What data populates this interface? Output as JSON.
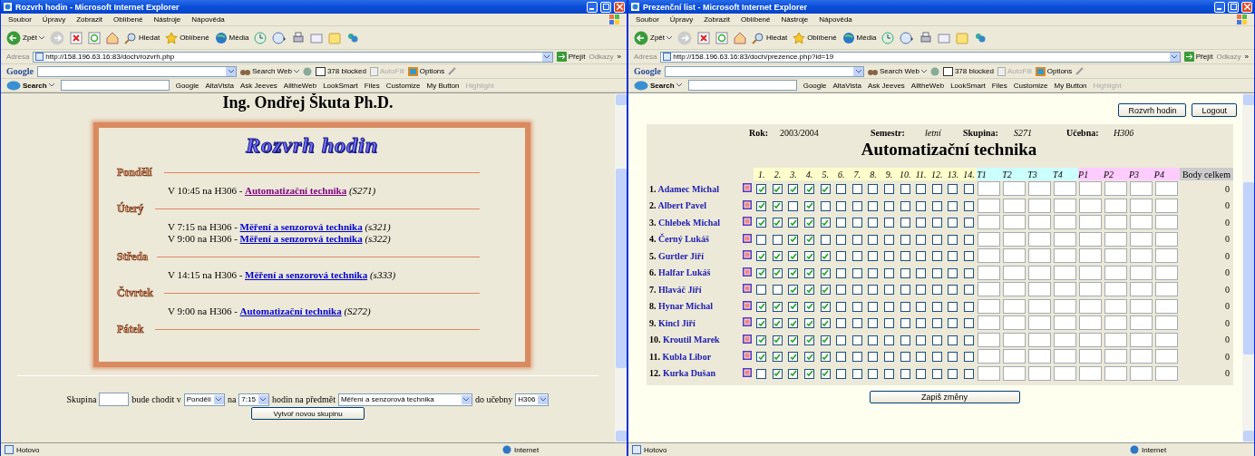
{
  "windows": [
    {
      "title": "Rozvrh hodin - Microsoft Internet Explorer",
      "menu": [
        "Soubor",
        "Úpravy",
        "Zobrazit",
        "Oblíbené",
        "Nástroje",
        "Nápověda"
      ],
      "toolbar": {
        "back": "Zpět",
        "search": "Hledat",
        "favorites": "Oblíbené",
        "media": "Média"
      },
      "address": {
        "label": "Adresa",
        "url": "http://158.196.63.16:83/doch/rozvrh.php",
        "go": "Přejít",
        "links": "Odkazy",
        "more": "»"
      },
      "google_bar": {
        "logo": "Google",
        "search_web": "Search Web",
        "blocked": "378 blocked",
        "autofill": "AutoFill",
        "options": "Options"
      },
      "search_bar": {
        "label": "Search",
        "items": [
          "Google",
          "AltaVista",
          "Ask Jeeves",
          "AlltheWeb",
          "LookSmart",
          "Files",
          "Customize",
          "My Button",
          "Highlight"
        ]
      },
      "status": {
        "text": "Hotovo",
        "zone": "Internet"
      },
      "kind": "schedule",
      "page": {
        "heading": "Ing. Ondřej Škuta Ph.D.",
        "title": "Rozvrh hodin",
        "days": [
          {
            "name": "Pondělí",
            "entries": [
              {
                "text": "V 10:45 na H306 - ",
                "link": "Automatizační technika",
                "visited": true,
                "group": "(S271)"
              }
            ]
          },
          {
            "name": "Úterý",
            "entries": [
              {
                "text": "V 7:15 na H306 - ",
                "link": "Měření a senzorová technika",
                "visited": false,
                "group": "(s321)"
              },
              {
                "text": "V 9:00 na H306 - ",
                "link": "Měření a senzorová technika",
                "visited": false,
                "group": "(s322)"
              }
            ]
          },
          {
            "name": "Středa",
            "entries": [
              {
                "text": "V 14:15 na H306 - ",
                "link": "Měření a senzorová technika",
                "visited": false,
                "group": "(s333)"
              }
            ]
          },
          {
            "name": "Čtvrtek",
            "entries": [
              {
                "text": "V 9:00 na H306 - ",
                "link": "Automatizační technika",
                "visited": false,
                "group": "(S272)"
              }
            ]
          },
          {
            "name": "Pátek"
          }
        ],
        "form": [
          {
            "kind": "label",
            "text": "Skupina"
          },
          {
            "kind": "input"
          },
          {
            "kind": "label",
            "text": "bude chodit v"
          },
          {
            "kind": "select",
            "value": "Pondělí"
          },
          {
            "kind": "label",
            "text": "na"
          },
          {
            "kind": "select",
            "value": "7:15"
          },
          {
            "kind": "label",
            "text": "hodin na předmět"
          },
          {
            "kind": "select",
            "value": "Měření a senzorová technika",
            "wide": true
          },
          {
            "kind": "label",
            "text": "do učebny"
          },
          {
            "kind": "select",
            "value": "H306"
          }
        ],
        "button": "Vytvoř novou skupinu"
      }
    },
    {
      "title": "Prezenční list - Microsoft Internet Explorer",
      "menu": [
        "Soubor",
        "Úpravy",
        "Zobrazit",
        "Oblíbené",
        "Nástroje",
        "Nápověda"
      ],
      "toolbar": {
        "back": "Zpět",
        "search": "Hledat",
        "favorites": "Oblíbené",
        "media": "Média"
      },
      "address": {
        "label": "Adresa",
        "url": "http://158.196.63.16:83/doch/prezence.php?id=19",
        "go": "Přejít",
        "links": "Odkazy",
        "more": "»"
      },
      "google_bar": {
        "logo": "Google",
        "search_web": "Search Web",
        "blocked": "378 blocked",
        "autofill": "AutoFill",
        "options": "Options"
      },
      "search_bar": {
        "label": "Search",
        "items": [
          "Google",
          "AltaVista",
          "Ask Jeeves",
          "AlltheWeb",
          "LookSmart",
          "Files",
          "Customize",
          "My Button",
          "Highlight"
        ]
      },
      "status": {
        "text": "Hotovo",
        "zone": "Internet"
      },
      "kind": "attendance",
      "page": {
        "buttons": [
          "Rozvrh hodin",
          "Logout"
        ],
        "info": [
          {
            "label": "Rok:",
            "value": "2003/2004"
          },
          {
            "label": "Semestr:",
            "value": "letní"
          },
          {
            "label": "Skupina:",
            "value": "S271"
          },
          {
            "label": "Učebna:",
            "value": "H306"
          }
        ],
        "title": "Automatizační technika",
        "columns": [
          {
            "label": "1.",
            "kind": "check",
            "color": "#ffffcc"
          },
          {
            "label": "2.",
            "kind": "check",
            "color": "#ffffcc"
          },
          {
            "label": "3.",
            "kind": "check",
            "color": "#ffffcc"
          },
          {
            "label": "4.",
            "kind": "check",
            "color": "#ffffcc"
          },
          {
            "label": "5.",
            "kind": "check",
            "color": "#ffffcc"
          },
          {
            "label": "6.",
            "kind": "check",
            "color": "#ffffcc"
          },
          {
            "label": "7.",
            "kind": "check",
            "color": "#ffffcc"
          },
          {
            "label": "8.",
            "kind": "check",
            "color": "#ffffcc"
          },
          {
            "label": "9.",
            "kind": "check",
            "color": "#ffffcc"
          },
          {
            "label": "10.",
            "kind": "check",
            "color": "#ffffcc"
          },
          {
            "label": "11.",
            "kind": "check",
            "color": "#ffffcc"
          },
          {
            "label": "12.",
            "kind": "check",
            "color": "#ffffcc"
          },
          {
            "label": "13.",
            "kind": "check",
            "color": "#ffffcc"
          },
          {
            "label": "14.",
            "kind": "check",
            "color": "#ffffcc"
          },
          {
            "label": "T1",
            "kind": "input",
            "color": "#ccffff"
          },
          {
            "label": "T2",
            "kind": "input",
            "color": "#ccffff"
          },
          {
            "label": "T3",
            "kind": "input",
            "color": "#ccffff"
          },
          {
            "label": "T4",
            "kind": "input",
            "color": "#ccffff"
          },
          {
            "label": "P1",
            "kind": "input",
            "color": "#ffccff"
          },
          {
            "label": "P2",
            "kind": "input",
            "color": "#ffccff"
          },
          {
            "label": "P3",
            "kind": "input",
            "color": "#ffccff"
          },
          {
            "label": "P4",
            "kind": "input",
            "color": "#ffccff"
          },
          {
            "label": "Body celkem",
            "kind": "total",
            "color": "#cccccc"
          }
        ],
        "rows": [
          {
            "number": "1.",
            "name": "Adamec Michal",
            "checks": [
              true,
              true,
              true,
              true,
              true,
              false,
              false,
              false,
              false,
              false,
              false,
              false,
              false,
              false
            ],
            "total": "0"
          },
          {
            "number": "2.",
            "name": "Albert Pavel",
            "checks": [
              true,
              true,
              false,
              true,
              false,
              false,
              false,
              false,
              false,
              false,
              false,
              false,
              false,
              false
            ],
            "total": "0"
          },
          {
            "number": "3.",
            "name": "Chlebek Michal",
            "checks": [
              true,
              true,
              true,
              true,
              true,
              false,
              false,
              false,
              false,
              false,
              false,
              false,
              false,
              false
            ],
            "total": "0"
          },
          {
            "number": "4.",
            "name": "Černý Lukáš",
            "checks": [
              false,
              false,
              true,
              true,
              false,
              false,
              false,
              false,
              false,
              false,
              false,
              false,
              false,
              false
            ],
            "total": "0"
          },
          {
            "number": "5.",
            "name": "Gurtler Jiří",
            "checks": [
              true,
              true,
              true,
              true,
              true,
              false,
              false,
              false,
              false,
              false,
              false,
              false,
              false,
              false
            ],
            "total": "0"
          },
          {
            "number": "6.",
            "name": "Halfar Lukáš",
            "checks": [
              true,
              true,
              true,
              true,
              true,
              false,
              false,
              false,
              false,
              false,
              false,
              false,
              false,
              false
            ],
            "total": "0"
          },
          {
            "number": "7.",
            "name": "Hlaváč Jiří",
            "checks": [
              false,
              false,
              true,
              true,
              true,
              false,
              false,
              false,
              false,
              false,
              false,
              false,
              false,
              false
            ],
            "total": "0"
          },
          {
            "number": "8.",
            "name": "Hynar Michal",
            "checks": [
              true,
              true,
              true,
              true,
              true,
              false,
              false,
              false,
              false,
              false,
              false,
              false,
              false,
              false
            ],
            "total": "0"
          },
          {
            "number": "9.",
            "name": "Kincl Jiří",
            "checks": [
              true,
              true,
              true,
              true,
              true,
              false,
              false,
              false,
              false,
              false,
              false,
              false,
              false,
              false
            ],
            "total": "0"
          },
          {
            "number": "10.",
            "name": "Kroutil Marek",
            "checks": [
              true,
              true,
              true,
              true,
              true,
              false,
              false,
              false,
              false,
              false,
              false,
              false,
              false,
              false
            ],
            "total": "0"
          },
          {
            "number": "11.",
            "name": "Kubla Libor",
            "checks": [
              true,
              true,
              true,
              true,
              true,
              false,
              false,
              false,
              false,
              false,
              false,
              false,
              false,
              false
            ],
            "total": "0"
          },
          {
            "number": "12.",
            "name": "Kurka Dušan",
            "checks": [
              false,
              true,
              true,
              true,
              true,
              false,
              false,
              false,
              false,
              false,
              false,
              false,
              false,
              false
            ],
            "total": "0"
          }
        ],
        "submit": "Zapiš změny"
      }
    }
  ]
}
